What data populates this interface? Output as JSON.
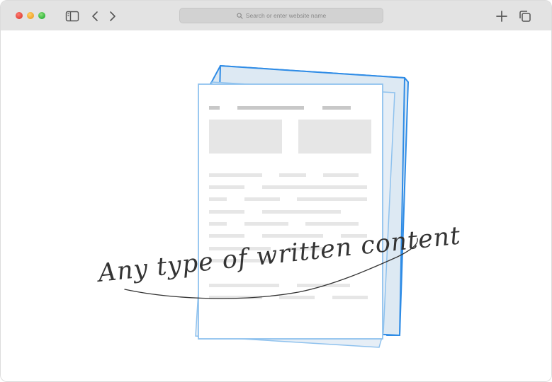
{
  "browser": {
    "address_bar": {
      "placeholder": "Search or enter website name"
    },
    "icons": {
      "sidebar": "sidebar-icon",
      "back": "chevron-left-icon",
      "forward": "chevron-right-icon",
      "search": "search-icon",
      "new_tab": "plus-icon",
      "tabs": "tabs-overview-icon"
    },
    "colors": {
      "toolbar": "#e3e3e3",
      "close": "#e0443a",
      "minimize": "#f0a429",
      "zoom": "#2fb43a"
    }
  },
  "illustration": {
    "caption": "Any type of written content",
    "colors": {
      "stroke_blue": "#2f8ce6",
      "sheet_fill": "#dde9f3",
      "placeholder": "#e6e6e6"
    }
  }
}
